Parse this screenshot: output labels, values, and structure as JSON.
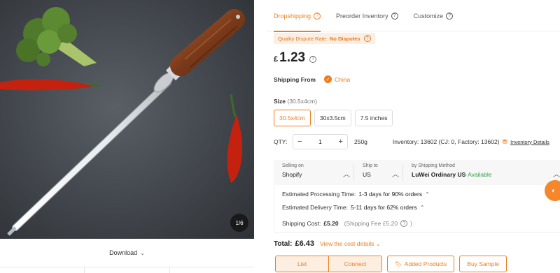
{
  "gallery": {
    "counter": "1/6",
    "download_label": "Download",
    "chevron": "⌵"
  },
  "tabs": [
    {
      "label": "Dropshipping",
      "active": true
    },
    {
      "label": "Preorder Inventory",
      "active": false
    },
    {
      "label": "Customize",
      "active": false
    }
  ],
  "dispute": {
    "label": "Quality Dispute Rate:",
    "value": "No Disputes"
  },
  "price": {
    "currency": "£",
    "value": "1.23"
  },
  "shipping_from": {
    "label": "Shipping From",
    "option": "China"
  },
  "size": {
    "label": "Size",
    "current": "(30.5x4cm)",
    "options": [
      "30.5x4cm",
      "30x3.5cm",
      "7.5 inches"
    ],
    "selected_index": 0
  },
  "qty": {
    "label": "QTY:",
    "minus": "−",
    "value": "1",
    "plus": "+",
    "weight": "250g",
    "inventory": "Inventory: 13602  (CJ: 0, Factory: 13602)",
    "inventory_link": "Inventory Details"
  },
  "shipping": {
    "selling_on_label": "Selling on",
    "selling_on_value": "Shopify",
    "ship_to_label": "Ship to",
    "ship_to_value": "US",
    "method_label": "by Shipping Method",
    "method_value": "LuWei Ordinary US",
    "method_status": "·Available",
    "processing_label": "Estimated Processing Time:",
    "processing_value": "1-3 days for 90% orders",
    "delivery_label": "Estimated Delivery Time:",
    "delivery_value": "5-11 days for 62% orders",
    "cost_label": "Shipping Cost:",
    "cost_value": "£5.20",
    "fee_note": "(Shipping Fee £5.20"
  },
  "total": {
    "label": "Total:",
    "amount": "£6.43",
    "link": "View the cost details"
  },
  "actions": {
    "list": "List",
    "connect": "Connect",
    "added_products": "Added Products",
    "buy_sample": "Buy Sample"
  },
  "colors": {
    "accent": "#f07c1a",
    "available": "#2da24a",
    "dispute_bg": "#fdeee2"
  },
  "icons": [
    "question-icon",
    "check-circle-icon",
    "chevron-up-icon",
    "bookmark-icon",
    "inventory-icon",
    "chevron-down-icon"
  ]
}
